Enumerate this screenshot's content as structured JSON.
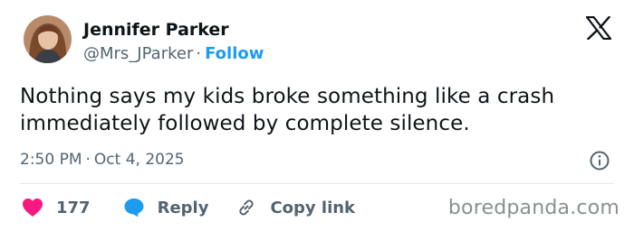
{
  "author": {
    "name": "Jennifer Parker",
    "handle": "@Mrs_JParker",
    "separator": "·",
    "follow_label": "Follow"
  },
  "tweet": {
    "text": "Nothing says my kids broke something like a crash immediately followed by complete silence.",
    "time": "2:50 PM",
    "date": "Oct 4, 2025",
    "meta_separator": "·"
  },
  "actions": {
    "like_count": "177",
    "reply_label": "Reply",
    "copy_link_label": "Copy link"
  },
  "watermark": {
    "text": "boredpanda.com"
  },
  "icons": {
    "logo": "x-logo-icon",
    "info": "info-icon",
    "like": "heart-icon",
    "reply": "speech-bubble-icon",
    "copy": "link-icon"
  },
  "colors": {
    "text": "#0f1419",
    "secondary": "#536471",
    "follow": "#1d9bf0",
    "heart": "#f91880",
    "reply_bubble": "#1d9bf0",
    "divider": "#e6e9eb"
  }
}
